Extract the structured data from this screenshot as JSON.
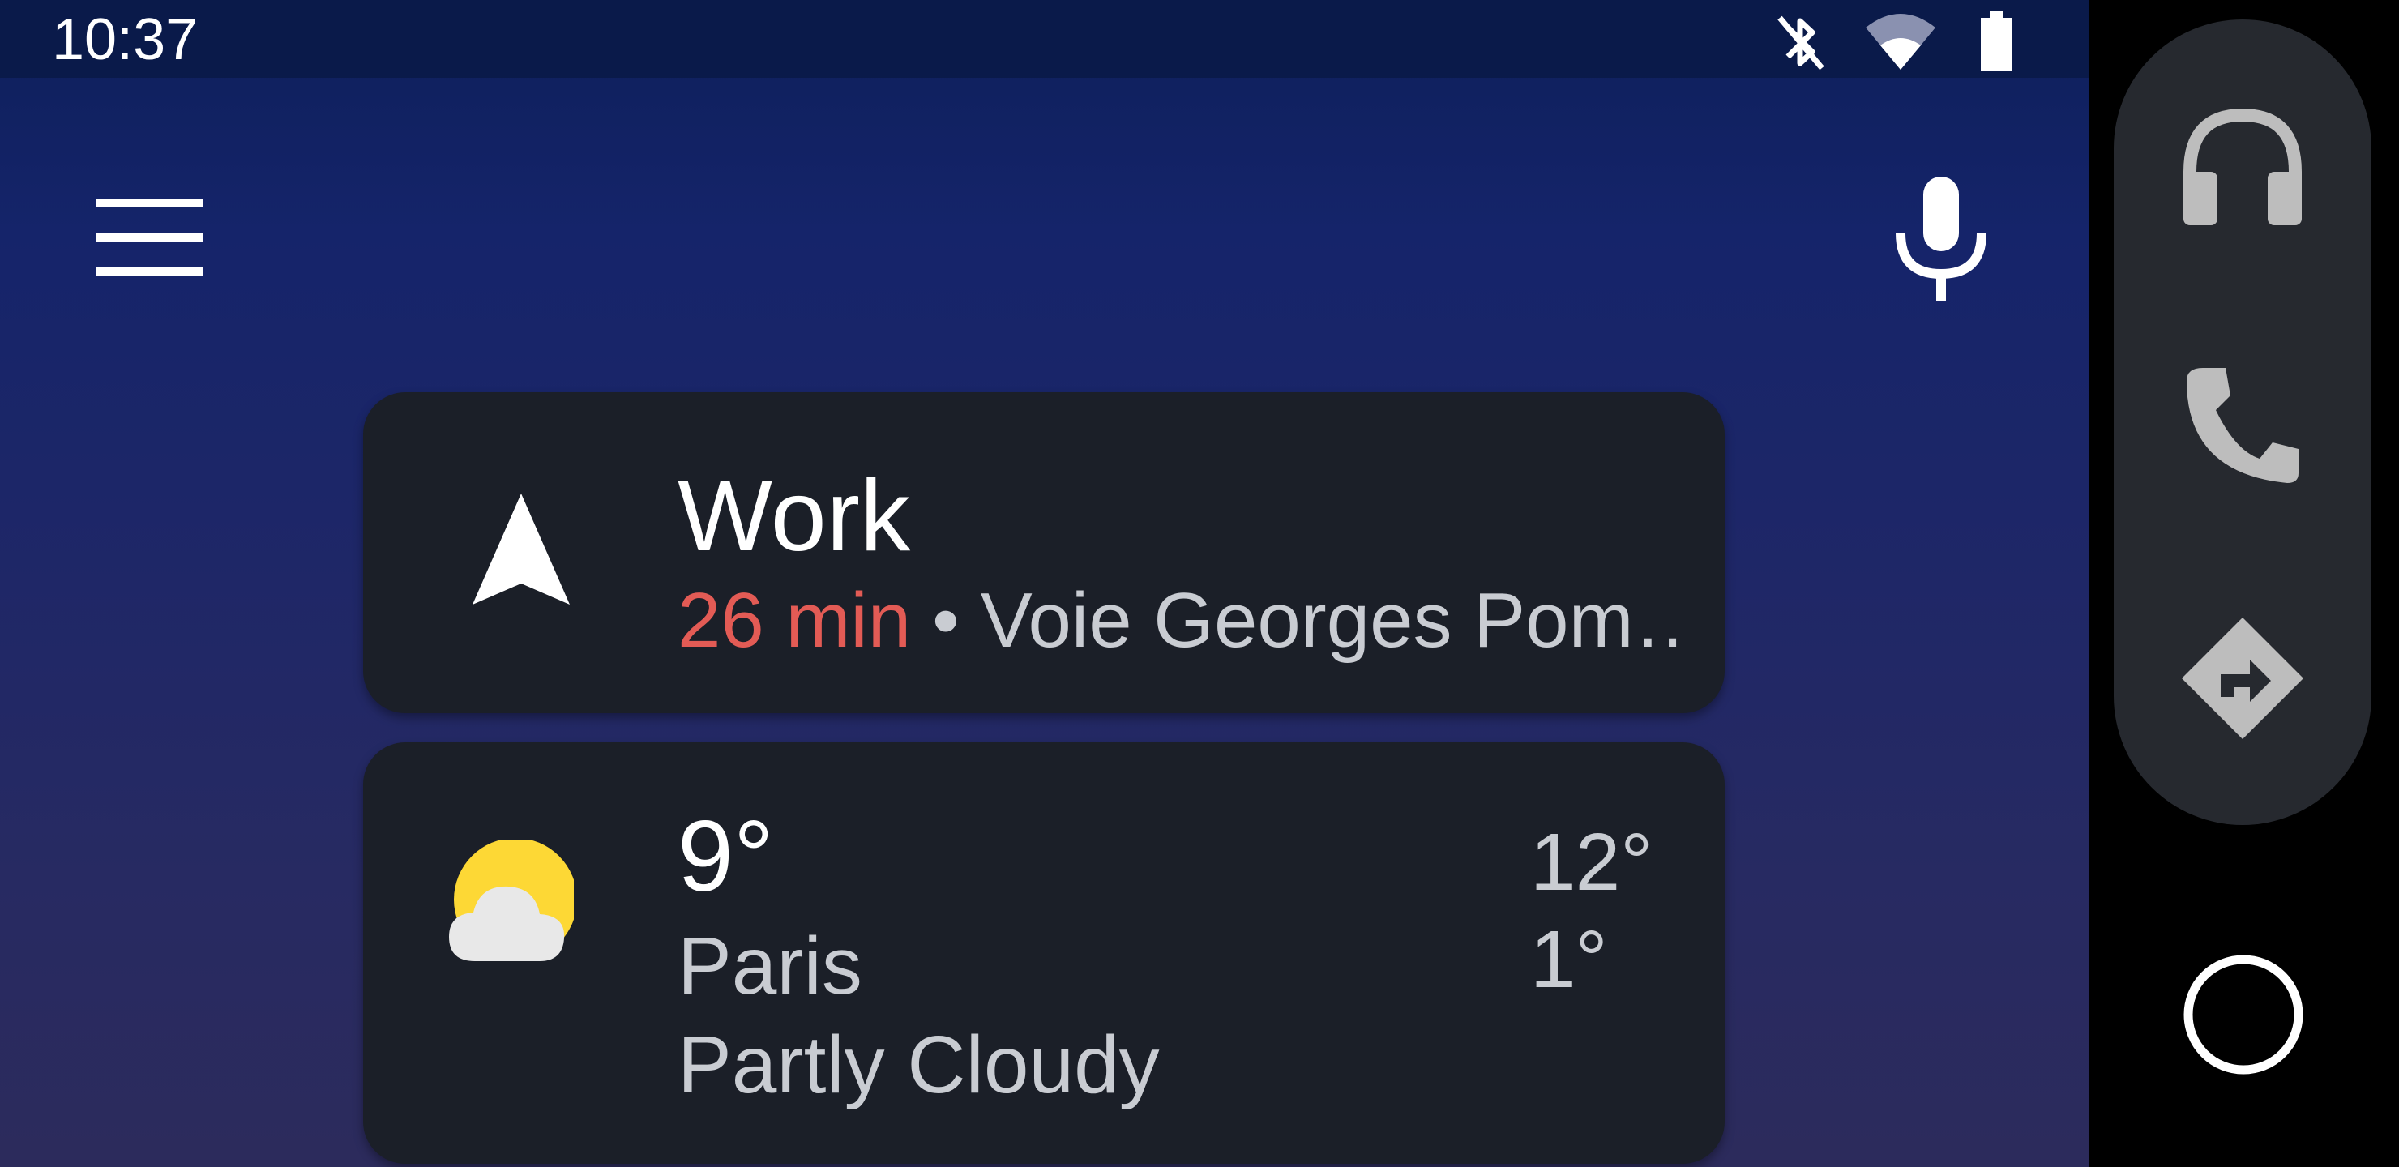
{
  "status_bar": {
    "time": "10:37",
    "icons": [
      "bluetooth-off-icon",
      "wifi-icon",
      "battery-icon"
    ]
  },
  "top_bar": {
    "menu_icon": "hamburger-menu-icon",
    "mic_icon": "microphone-icon"
  },
  "navigation_card": {
    "icon": "navigation-arrow-icon",
    "title": "Work",
    "eta": "26 min",
    "separator": "•",
    "route": "Voie Georges Pom…"
  },
  "weather_card": {
    "icon": "partly-cloudy-icon",
    "current_temp": "9°",
    "city": "Paris",
    "condition": "Partly Cloudy",
    "high": "12°",
    "low": "1°"
  },
  "rail": {
    "buttons": [
      "headphones-icon",
      "phone-icon",
      "directions-icon"
    ],
    "home": "home-circle-icon"
  },
  "colors": {
    "accent_eta": "#e35b55",
    "card_bg": "#1b1f28",
    "rail_pill": "#26292f",
    "icon_gray": "#bdbdbd",
    "sun_yellow": "#fdd835"
  }
}
